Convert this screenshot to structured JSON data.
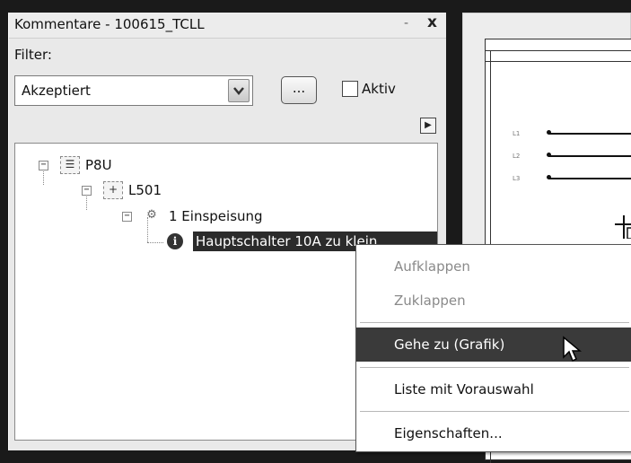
{
  "panel": {
    "title": "Kommentare - 100615_TCLL",
    "pin_glyph": "-",
    "close_glyph": "x",
    "filter_label": "Filter:",
    "filter_value": "Akzeptiert",
    "dots_label": "...",
    "aktiv_label": "Aktiv",
    "aktiv_checked": false
  },
  "tree": {
    "nodes": [
      {
        "label": "P8U",
        "level": 0,
        "icon": "structure-icon",
        "expander": "−"
      },
      {
        "label": "L501",
        "level": 1,
        "icon": "location-icon",
        "expander": "−"
      },
      {
        "label": "1 Einspeisung",
        "level": 2,
        "icon": "function-icon",
        "expander": "−"
      },
      {
        "label": "Hauptschalter 10A zu klein",
        "level": 3,
        "icon": "info-icon",
        "selected": true
      }
    ]
  },
  "context_menu": {
    "items": [
      {
        "label": "Aufklappen",
        "enabled": false
      },
      {
        "label": "Zuklappen",
        "enabled": false
      },
      {
        "label": "Gehe zu (Grafik)",
        "enabled": true,
        "highlighted": true
      },
      {
        "label": "Liste mit Vorauswahl",
        "enabled": true
      },
      {
        "label": "Eigenschaften...",
        "enabled": true
      }
    ]
  },
  "drawing": {
    "signals": [
      "L1",
      "L2",
      "L3"
    ]
  }
}
